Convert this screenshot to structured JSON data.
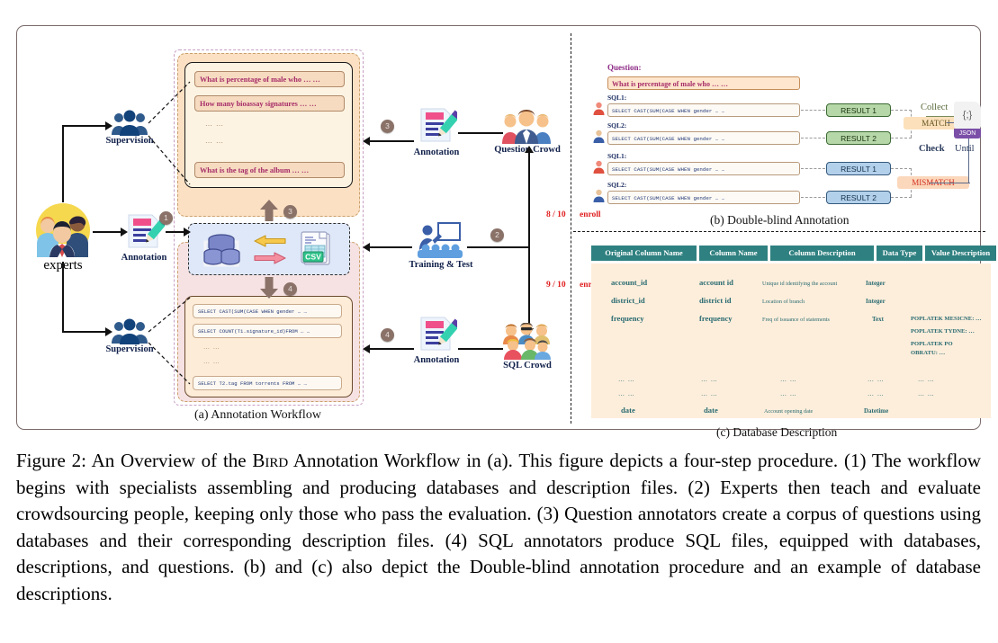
{
  "figure": {
    "caption_prefix": "Figure 2:",
    "caption": "Figure 2:  An Overview of the BIRD Annotation Workflow in (a).  This figure depicts a four-step procedure.  (1) The workflow begins with specialists assembling and producing databases and description files. (2) Experts then teach and evaluate crowdsourcing people, keeping only those who pass the evaluation. (3) Question annotators create a corpus of questions using databases and their corresponding description files. (4) SQL annotators produce SQL files, equipped with databases, descriptions, and questions. (b) and (c) also depict the Double-blind annotation procedure and an example of database descriptions.",
    "caption_part1": "Figure 2:  An Overview of the ",
    "caption_smallcaps": "Bird",
    "caption_part2": " Annotation Workflow in (a).  This figure depicts a four-step procedure.  (1) The workflow begins with specialists assembling and producing databases and description files. (2) Experts then teach and evaluate crowdsourcing people, keeping only those who pass the evaluation. (3) Question annotators create a corpus of questions using databases and their corresponding description files. (4) SQL annotators produce SQL files, equipped with databases, descriptions, and questions. (b) and (c) also depict the Double-blind annotation procedure and an example of database descriptions."
  },
  "panel_a": {
    "caption": "(a) Annotation Workflow",
    "experts_label": "experts",
    "annotation_label_top": "Annotation",
    "annotation_label_mid": "Annotation",
    "annotation_label_bottom": "Annotation",
    "supervision_label_top": "Supervision",
    "supervision_label_bottom": "Supervision",
    "training_label": "Training & Test",
    "question_crowd_label": "Question Crowd",
    "sql_crowd_label": "SQL Crowd",
    "steps": [
      "1",
      "2",
      "3",
      "4",
      "3",
      "4"
    ],
    "question_items": [
      "What is percentage of male who … …",
      "How many bioassay signatures … …",
      "… …",
      "… …",
      "What is the tag of the album … …"
    ],
    "sql_items": [
      "SELECT CAST(SUM(CASE WHEN gender … …",
      "SELECT COUNT(T1.signature_id)FROM … …",
      "… …",
      "… …",
      "SELECT T2.tag FROM torrents FROM … …"
    ],
    "csv_badge": "CSV",
    "enroll_top_ratio": "8 / 10",
    "enroll_top_word": "enroll",
    "enroll_bottom_ratio": "9 / 10",
    "enroll_bottom_word": "enroll"
  },
  "panel_b": {
    "caption": "(b) Double-blind Annotation",
    "question_label": "Question:",
    "question_text": "What is percentage of male who … …",
    "rows": [
      {
        "sql_label": "SQL1:",
        "sql_text": "SELECT  CAST(SUM(CASE  WHEN  gender  … …",
        "result": "RESULT 1",
        "result_color": "green"
      },
      {
        "sql_label": "SQL2:",
        "sql_text": "SELECT  CAST(SUM(CASE  WHEN  gender  … …",
        "result": "RESULT 2",
        "result_color": "green"
      },
      {
        "sql_label": "SQL1:",
        "sql_text": "SELECT  CAST(SUM(CASE  WHEN  gender  … …",
        "result": "RESULT 1",
        "result_color": "blue"
      },
      {
        "sql_label": "SQL2:",
        "sql_text": "SELECT  CAST(SUM(CASE  WHEN  gender  … …",
        "result": "RESULT 2",
        "result_color": "blue"
      }
    ],
    "match_label": "MATCH",
    "mismatch_label": "MISMATCH",
    "collect_label": "Collect",
    "check_label": "Check",
    "until_label": "Until",
    "json_glyph": "{;}",
    "json_tag": "JSON"
  },
  "panel_c": {
    "caption": "(c) Database Description",
    "headers": [
      "Original Column Name",
      "Column Name",
      "Column Description",
      "Data Type",
      "Value Description"
    ],
    "rows": [
      {
        "original": "account_id",
        "name": "account id",
        "description": "Unique id identifying the account",
        "type": "Integer",
        "value": ""
      },
      {
        "original": "district_id",
        "name": "district id",
        "description": "Location of branch",
        "type": "Integer",
        "value": ""
      },
      {
        "original": "frequency",
        "name": "frequency",
        "description": "Freq of issuance of statements",
        "type": "Text",
        "value_lines": [
          "POPLATEK MESICNE: …",
          "POPLATEK TYDNE: …",
          "POPLATEK PO",
          "OBRATU: …"
        ]
      },
      {
        "original": "… …",
        "name": "… …",
        "description": "… …",
        "type": "… …",
        "value": "… …"
      },
      {
        "original": "… …",
        "name": "… …",
        "description": "… …",
        "type": "… …",
        "value": "… …"
      },
      {
        "original": "date",
        "name": "date",
        "description": "Account opening date",
        "type": "Datetime",
        "value": ""
      }
    ]
  },
  "colors": {
    "table_header_bg": "#2f8080",
    "table_body_bg": "#fdeedb",
    "table_text": "#2a6b72",
    "question_text": "#a62b68",
    "sql_text": "#223a78",
    "result_green": "#b6d7a8",
    "result_blue": "#b3d0ea",
    "match_bg": "#fbe0bb",
    "mismatch_bg": "#fbd7bb",
    "mismatch_text": "#d32f1f",
    "enroll_red": "#e02020",
    "step_badge": "#8a7268",
    "peach_panel": "#fbe0c3",
    "json_purple": "#7b4fa8"
  }
}
